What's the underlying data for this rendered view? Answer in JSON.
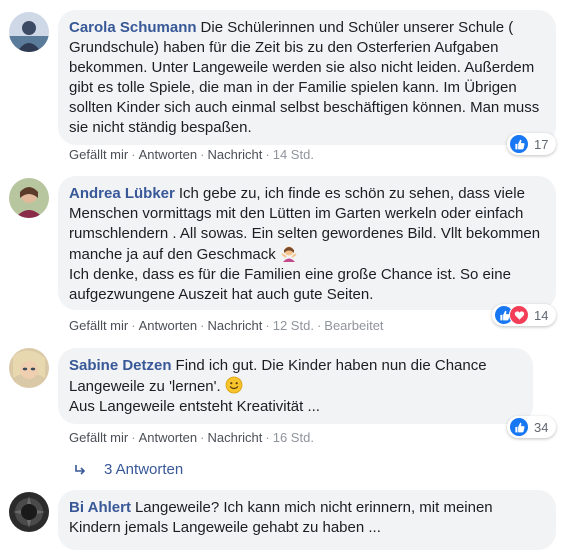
{
  "comments": [
    {
      "author": "Carola Schumann",
      "text": "Die Schülerinnen und Schüler unserer Schule ( Grundschule) haben für die Zeit bis zu den Osterferien Aufgaben bekommen. Unter Langeweile werden sie also nicht leiden. Außerdem gibt es tolle Spiele, die man in der Familie spielen kann. Im Übrigen sollten Kinder sich auch einmal selbst beschäftigen können. Man muss sie nicht ständig bespaßen.",
      "actions": {
        "like": "Gefällt mir",
        "reply": "Antworten",
        "message": "Nachricht",
        "time": "14 Std."
      },
      "reactions": {
        "count": "17",
        "types": [
          "like"
        ]
      }
    },
    {
      "author": "Andrea Lübker",
      "text_part1": "Ich gebe zu, ich finde es schön zu sehen, dass viele Menschen vormittags mit den Lütten im Garten werkeln oder einfach rumschlendern . All sowas. Ein selten gewordenes Bild. Vllt bekommen manche ja auf den Geschmack",
      "text_part2": "Ich denke, dass es für die Familien eine große Chance ist. So eine aufgezwungene Auszeit hat auch gute Seiten.",
      "actions": {
        "like": "Gefällt mir",
        "reply": "Antworten",
        "message": "Nachricht",
        "time": "12 Std.",
        "edited": "Bearbeitet"
      },
      "reactions": {
        "count": "14",
        "types": [
          "like",
          "love"
        ]
      }
    },
    {
      "author": "Sabine Detzen",
      "text_part1": "Find ich gut. Die Kinder haben nun die Chance Langeweile zu 'lernen'.",
      "text_part2": "Aus Langeweile entsteht Kreativität ...",
      "actions": {
        "like": "Gefällt mir",
        "reply": "Antworten",
        "message": "Nachricht",
        "time": "16 Std."
      },
      "reactions": {
        "count": "34",
        "types": [
          "like"
        ]
      },
      "replies_label": "3 Antworten"
    },
    {
      "author": "Bi Ahlert",
      "text": "Langeweile? Ich kann mich nicht erinnern, mit meinen Kindern jemals Langeweile gehabt zu haben ..."
    }
  ],
  "colors": {
    "author": "#385898",
    "bubble": "#f2f3f5",
    "like": "#1877f2",
    "love": "#f33e58"
  }
}
